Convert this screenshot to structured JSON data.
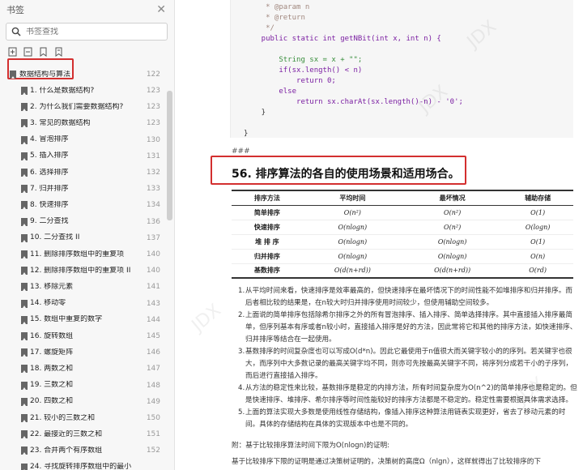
{
  "sidebar": {
    "title": "书签",
    "search_placeholder": "书签查找",
    "root": {
      "label": "数据结构与算法",
      "page": "122"
    },
    "items": [
      {
        "label": "1.  什么是数据结构?",
        "page": "123"
      },
      {
        "label": "2.  为什么我们需要数据结构?",
        "page": "123"
      },
      {
        "label": "3.  常见的数据结构",
        "page": "123"
      },
      {
        "label": "4.  冒泡排序",
        "page": "130"
      },
      {
        "label": "5.  插入排序",
        "page": "131"
      },
      {
        "label": "6.  选择排序",
        "page": "132"
      },
      {
        "label": "7.  归并排序",
        "page": "133"
      },
      {
        "label": "8.  快速排序",
        "page": "134"
      },
      {
        "label": "9.  二分查找",
        "page": "136"
      },
      {
        "label": "10.  二分查找 II",
        "page": "137"
      },
      {
        "label": "11.  删除排序数组中的重复项",
        "page": "140"
      },
      {
        "label": "12.  删除排序数组中的重复项 II",
        "page": "140"
      },
      {
        "label": "13.  移除元素",
        "page": "141"
      },
      {
        "label": "14.  移动零",
        "page": "143"
      },
      {
        "label": "15.  数组中重复的数字",
        "page": "144"
      },
      {
        "label": "16.  旋转数组",
        "page": "145"
      },
      {
        "label": "17.  螺旋矩阵",
        "page": "146"
      },
      {
        "label": "18.  两数之和",
        "page": "147"
      },
      {
        "label": "19.  三数之和",
        "page": "148"
      },
      {
        "label": "20.  四数之和",
        "page": "149"
      },
      {
        "label": "21.  较小的三数之和",
        "page": "150"
      },
      {
        "label": "22.  最接近的三数之和",
        "page": "151"
      },
      {
        "label": "23.  合并两个有序数组",
        "page": "152"
      },
      {
        "label": "24.  寻找旋转排序数组中的最小",
        "page": ""
      }
    ]
  },
  "code": {
    "lines": [
      {
        "t": "     * @param n",
        "c": "com"
      },
      {
        "t": "     * @return",
        "c": "com"
      },
      {
        "t": "     */",
        "c": "com"
      },
      {
        "t": "    public static int getNBit(int x, int n) {",
        "c": "kw"
      },
      {
        "t": "",
        "c": "plain"
      },
      {
        "t": "        String sx = x + \"\";",
        "c": "str"
      },
      {
        "t": "        if(sx.length() < n)",
        "c": "kw"
      },
      {
        "t": "            return 0;",
        "c": "kw"
      },
      {
        "t": "        else",
        "c": "kw"
      },
      {
        "t": "            return sx.charAt(sx.length()-n) - '0';",
        "c": "kw"
      },
      {
        "t": "    }",
        "c": "plain"
      },
      {
        "t": "",
        "c": "plain"
      },
      {
        "t": "}",
        "c": "plain"
      }
    ]
  },
  "doc": {
    "hash": "###",
    "section_title": "56. 排序算法的各自的使用场景和适用场合。",
    "table": {
      "headers": [
        "排序方法",
        "平均时间",
        "最坏情况",
        "辅助存储"
      ],
      "rows": [
        [
          "简单排序",
          "O(n²)",
          "O(n²)",
          "O(1)"
        ],
        [
          "快速排序",
          "O(nlogn)",
          "O(n²)",
          "O(logn)"
        ],
        [
          "堆 排 序",
          "O(nlogn)",
          "O(nlogn)",
          "O(1)"
        ],
        [
          "归并排序",
          "O(nlogn)",
          "O(nlogn)",
          "O(n)"
        ],
        [
          "基数排序",
          "O(d(n+rd))",
          "O(d(n+rd))",
          "O(rd)"
        ]
      ]
    },
    "notes": [
      {
        "num": "1.",
        "text": "从平均时间来看，快速排序是效率最高的，但快速排序在最坏情况下的时间性能不如堆排序和归并排序。而后者相比较的结果是，在n较大时归并排序使用时间较少，但使用辅助空间较多。"
      },
      {
        "num": "2.",
        "text": "上面说的简单排序包括除希尔排序之外的所有冒泡排序、插入排序、简单选择排序。其中直接插入排序最简单，但序列基本有序或者n较小时，直接插入排序是好的方法，因此常将它和其他的排序方法，如快速排序、归并排序等结合在一起使用。"
      },
      {
        "num": "3.",
        "text": "基数排序的时间复杂度也可以写成O(d*n)。因此它最使用于n值很大而关键字较小的的序列。若关键字也很大，而序列中大多数记录的最高关键字均不同，则亦可先按最高关键字不同，将序列分成若干小的子序列，而后进行直接插入排序。"
      },
      {
        "num": "4.",
        "text": "从方法的稳定性来比较，基数排序是稳定的内排方法，所有时间复杂度为O(n^2)的简单排序也是稳定的。但是快速排序、堆排序、希尔排序等时间性能较好的排序方法都是不稳定的。稳定性需要根据具体需求选择。"
      },
      {
        "num": "5.",
        "text": "上面的算法实现大多数是使用线性存储结构，像插入排序这种算法用链表实现更好，省去了移动元素的时间。具体的存储结构在具体的实现版本中也是不同的。"
      }
    ],
    "appendix": "附：基于比较排序算法时间下限为O(nlogn)的证明:",
    "footer": "基于比较排序下限的证明是通过决策树证明的，决策树的高度Ω（nlgn），这样就得出了比较排序的下"
  }
}
